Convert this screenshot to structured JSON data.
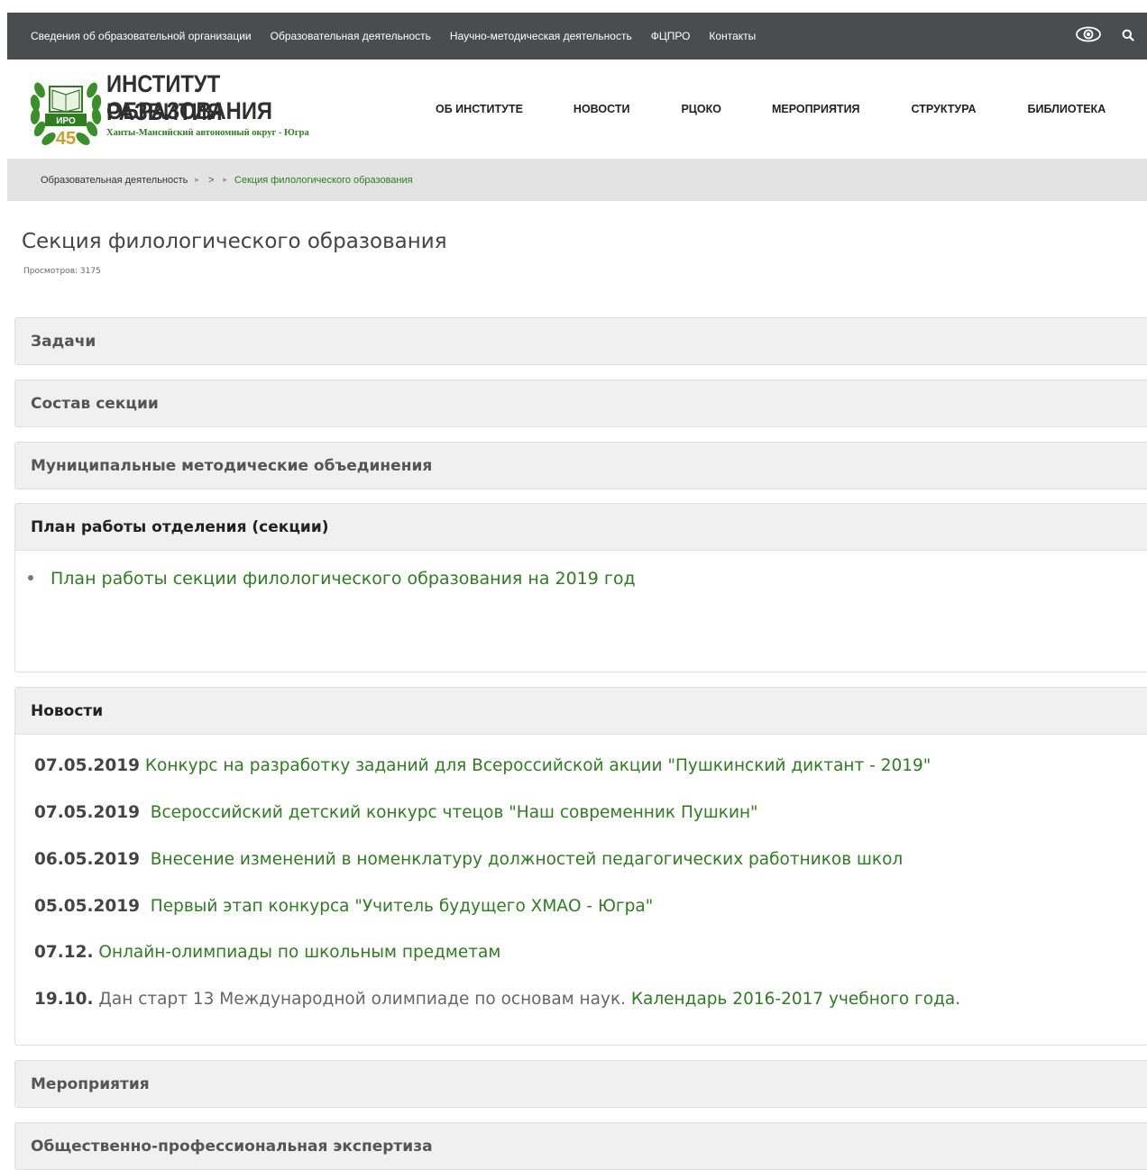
{
  "topnav": {
    "items": [
      "Сведения об образовательной организации",
      "Образовательная деятельность",
      "Научно-методическая деятельность",
      "ФЦПРО",
      "Контакты"
    ],
    "icons": [
      "eye-icon",
      "search-icon"
    ]
  },
  "logo": {
    "line1": "ИНСТИТУТ РАЗВИТИЯ",
    "line2": "ОБРАЗОВАНИЯ",
    "subtitle": "Ханты-Мансийский автономный округ - Югра",
    "badge": "ИРО",
    "years": "45"
  },
  "mainnav": {
    "items": [
      "ОБ ИНСТИТУТЕ",
      "НОВОСТИ",
      "РЦОКО",
      "МЕРОПРИЯТИЯ",
      "СТРУКТУРА",
      "БИБЛИОТЕКА"
    ]
  },
  "breadcrumb": {
    "first": "Образовательная деятельность",
    "middle": ">",
    "current": "Секция филологического образования"
  },
  "page": {
    "title": "Секция филологического образования",
    "views": "Просмотров: 3175"
  },
  "panels": {
    "tasks": "Задачи",
    "staff": "Состав секции",
    "municipal": "Муниципальные методические объединения",
    "plan": {
      "title": "План работы отделения (секции)",
      "link": "План работы секции филологического образования на 2019 год"
    },
    "news": {
      "title": "Новости",
      "items": [
        {
          "date": "07.05.2019",
          "text": " Конкурс на разработку заданий для Всероссийской акции \"Пушкинский диктант - 2019\""
        },
        {
          "date": "07.05.2019",
          "text": "  Всероссийский детский конкурс чтецов \"Наш современник Пушкин\""
        },
        {
          "date": "06.05.2019",
          "text": "  Внесение изменений в номенклатуру должностей педагогических работников школ"
        },
        {
          "date": "05.05.2019",
          "text": "  Первый этап конкурса \"Учитель будущего ХМАО - Югра\""
        },
        {
          "date": "07.12.",
          "text": " Онлайн-олимпиады по школьным предметам"
        },
        {
          "date": "19.10.",
          "text": " Дан старт 13 Международной олимпиаде по основам наук.",
          "link": " Календарь 2016-2017 учебного года."
        }
      ]
    },
    "events": "Мероприятия",
    "expertise": "Общественно-профессиональная экспертиза"
  },
  "colors": {
    "topbar": "#4a4d50",
    "accent_green": "#2e7d21",
    "breadcrumb_bg": "#e3e3e3",
    "panel_head_bg": "#f0f0f0"
  }
}
